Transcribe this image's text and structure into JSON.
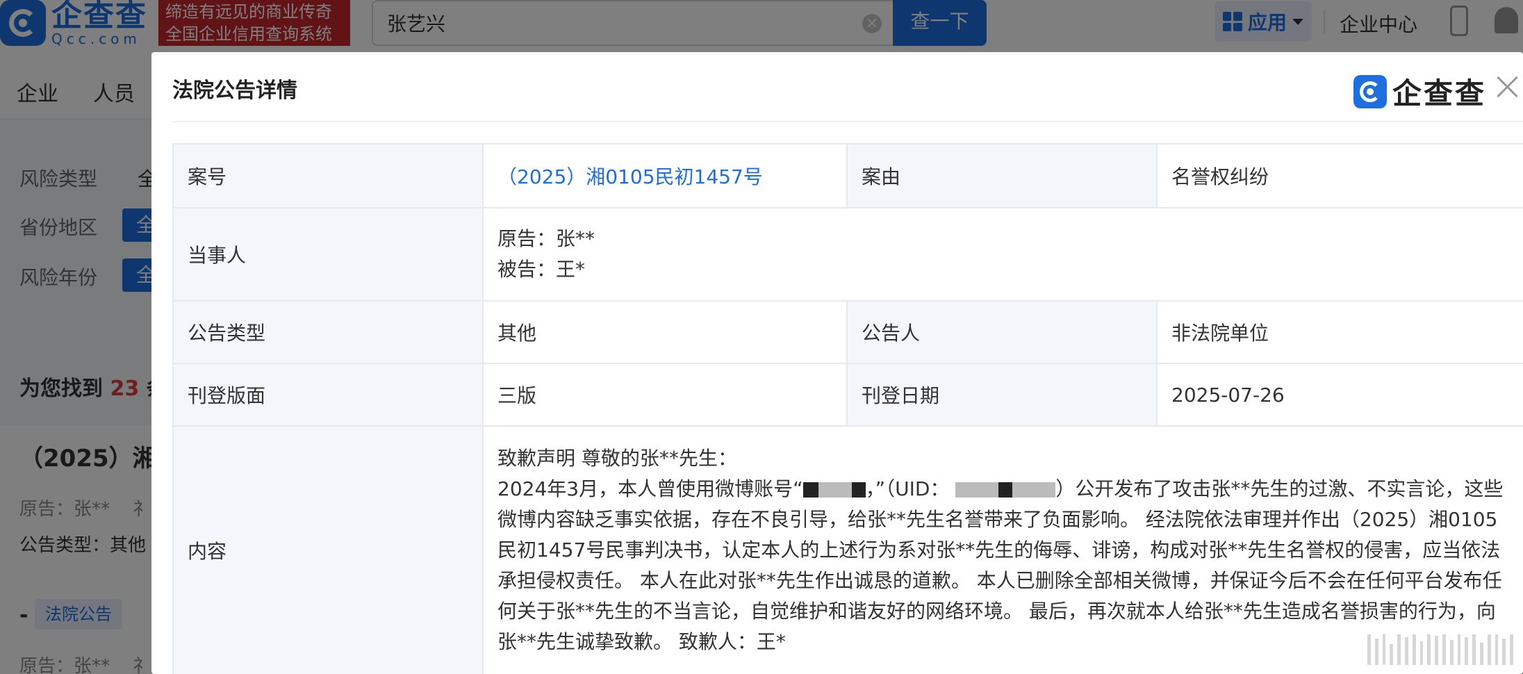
{
  "header": {
    "logo_cn": "企查查",
    "logo_en": "Qcc.com",
    "slogan_line1": "缔造有远见的商业传奇",
    "slogan_line2": "全国企业信用查询系统",
    "search_value": "张艺兴",
    "search_button": "查一下",
    "apps_label": "应用",
    "enterprise_center": "企业中心"
  },
  "nav": {
    "items": [
      "企业",
      "人员"
    ]
  },
  "filters": {
    "risk_type_label": "风险类型",
    "risk_type_value": "全",
    "province_label": "省份地区",
    "province_value": "全",
    "year_label": "风险年份",
    "year_value": "全"
  },
  "results": {
    "prefix": "为您找到",
    "count": "23",
    "suffix": "条"
  },
  "result_card": {
    "title": "（2025）湘",
    "plaintiff": "原告：张**",
    "plaintiff_tail": "礻",
    "notice_type": "公告类型：其他",
    "tag": "法院公告",
    "dash": "-",
    "plaintiff2": "原告：张**",
    "plaintiff2_tail": "礻"
  },
  "modal": {
    "title": "法院公告详情",
    "logo_text": "企查查",
    "rows": {
      "case_no_label": "案号",
      "case_no_value": "（2025）湘0105民初1457号",
      "cause_label": "案由",
      "cause_value": "名誉权纠纷",
      "party_label": "当事人",
      "plaintiff": "原告：张**",
      "defendant": "被告：王*",
      "notice_type_label": "公告类型",
      "notice_type_value": "其他",
      "announcer_label": "公告人",
      "announcer_value": "非法院单位",
      "layout_label": "刊登版面",
      "layout_value": "三版",
      "date_label": "刊登日期",
      "date_value": "2025-07-26",
      "content_label": "内容",
      "content_line1": "致歉声明 尊敬的张**先生：",
      "content_p1_a": "2024年3月，本人曾使用微博账号“",
      "content_p1_b": "，”（UID：",
      "content_p1_c": "）公开发布了攻击张**先生的过激、不实言论，这些微博内容缺乏事实依据，存在不良引导，给张**先生名誉带来了负面影响。 经法院依法审理并作出（2025）湘0105民初1457号民事判决书，认定本人的上述行为系对张**先生的侮辱、诽谤，构成对张**先生名誉权的侵害，应当依法承担侵权责任。 本人在此对张**先生作出诚恳的道歉。 本人已删除全部相关微博，并保证今后不会在任何平台发布任何关于张**先生的不当言论，自觉维护和谐友好的网络环境。 最后，再次就本人给张**先生造成名誉损害的行为，向张**先生诚挚致歉。 致歉人：王*"
    }
  }
}
